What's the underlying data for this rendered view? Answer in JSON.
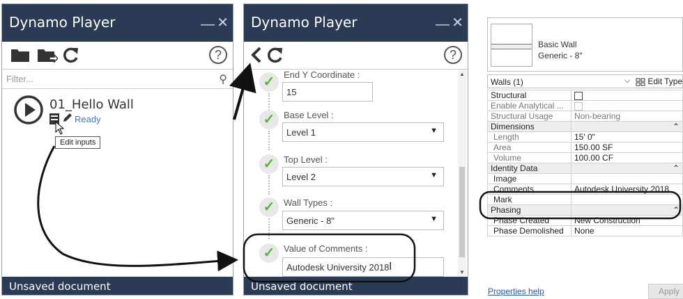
{
  "left_player": {
    "title": "Dynamo Player",
    "minimize": "—",
    "close": "✕",
    "filter_placeholder": "Filter...",
    "help": "?",
    "script": {
      "name": "01_Hello Wall",
      "status": "Ready"
    },
    "tooltip": "Edit inputs",
    "status_bar": "Unsaved document"
  },
  "right_player": {
    "title": "Dynamo Player",
    "minimize": "—",
    "close": "✕",
    "help": "?",
    "fields": [
      {
        "label": "End Y Coordinate :",
        "value": "15"
      },
      {
        "label": "Base Level :",
        "value": "Level 1"
      },
      {
        "label": "Top Level :",
        "value": "Level 2"
      },
      {
        "label": "Wall Types :",
        "value": "Generic - 8\""
      },
      {
        "label": "Value of Comments :",
        "value": "Autodesk University 2018"
      }
    ],
    "status_bar": "Unsaved document"
  },
  "properties": {
    "type_name_line1": "Basic Wall",
    "type_name_line2": "Generic - 8\"",
    "selection": "Walls (1)",
    "edit_type": "Edit Type",
    "rows": [
      {
        "k": "Structural",
        "v": ""
      },
      {
        "k": "Enable Analytical ...",
        "v": ""
      },
      {
        "k": "Structural Usage",
        "v": "Non-bearing"
      },
      {
        "k": "Dimensions",
        "v": ""
      },
      {
        "k": "Length",
        "v": "15'  0\""
      },
      {
        "k": "Area",
        "v": "150.00 SF"
      },
      {
        "k": "Volume",
        "v": "100.00 CF"
      },
      {
        "k": "Identity Data",
        "v": ""
      },
      {
        "k": "Image",
        "v": ""
      },
      {
        "k": "Comments",
        "v": "Autodesk University 2018"
      },
      {
        "k": "Mark",
        "v": ""
      },
      {
        "k": "Phasing",
        "v": ""
      },
      {
        "k": "Phase Created",
        "v": "New Construction"
      },
      {
        "k": "Phase Demolished",
        "v": "None"
      }
    ],
    "help_link": "Properties help",
    "apply": "Apply"
  }
}
